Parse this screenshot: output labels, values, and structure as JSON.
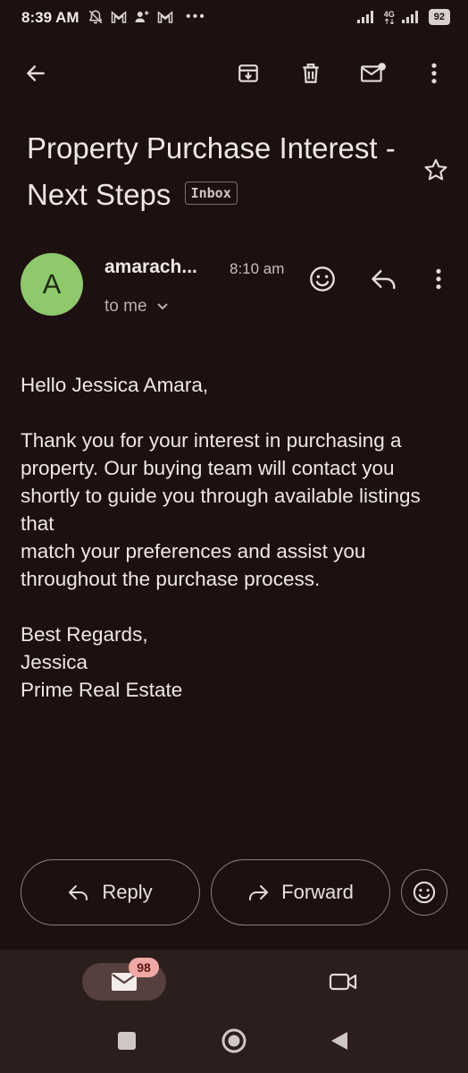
{
  "status_bar": {
    "time": "8:39 AM",
    "battery": "92",
    "network": "4G"
  },
  "toolbar": {
    "icons": [
      "back-arrow-icon",
      "archive-icon",
      "delete-icon",
      "mark-unread-icon",
      "more-vert-icon"
    ]
  },
  "email": {
    "subject": "Property Purchase Interest - Next Steps",
    "label": "Inbox",
    "sender_initial": "A",
    "sender_name": "amarach...",
    "time": "8:10 am",
    "recipient": "to me",
    "body": "Hello Jessica Amara,\n\nThank you for your interest in purchasing a property. Our buying team will contact you shortly to guide you through available listings that\nmatch your preferences and assist you throughout the purchase process.\n\nBest Regards,\nJessica\nPrime Real Estate"
  },
  "actions": {
    "reply_label": "Reply",
    "forward_label": "Forward"
  },
  "bottom_nav": {
    "mail_badge": "98"
  },
  "colors": {
    "background": "#1c1010",
    "avatar": "#8ec96b",
    "badge": "#f0a8a4"
  }
}
